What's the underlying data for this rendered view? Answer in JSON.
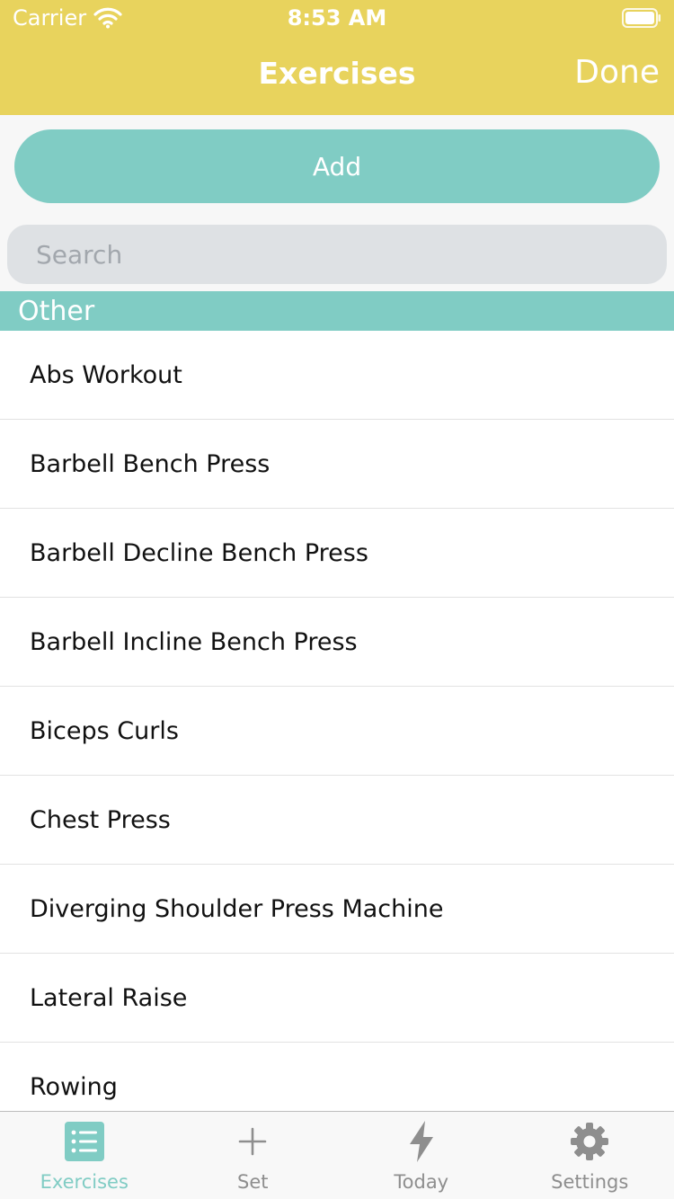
{
  "status_bar": {
    "carrier": "Carrier",
    "time": "8:53 AM"
  },
  "nav": {
    "title": "Exercises",
    "done_label": "Done"
  },
  "colors": {
    "header": "#E8D35D",
    "accent": "#80CCC4",
    "search_bg": "#DEE1E4",
    "tab_inactive": "#8E8E8E"
  },
  "actions": {
    "add_label": "Add"
  },
  "search": {
    "placeholder": "Search",
    "value": ""
  },
  "section": {
    "title": "Other"
  },
  "exercises": [
    "Abs Workout",
    "Barbell Bench Press",
    "Barbell Decline Bench Press",
    "Barbell Incline Bench Press",
    "Biceps Curls",
    "Chest Press",
    "Diverging Shoulder Press Machine",
    "Lateral Raise",
    "Rowing"
  ],
  "tabs": [
    {
      "label": "Exercises",
      "icon": "list-icon",
      "active": true
    },
    {
      "label": "Set",
      "icon": "plus-icon",
      "active": false
    },
    {
      "label": "Today",
      "icon": "bolt-icon",
      "active": false
    },
    {
      "label": "Settings",
      "icon": "gear-icon",
      "active": false
    }
  ]
}
